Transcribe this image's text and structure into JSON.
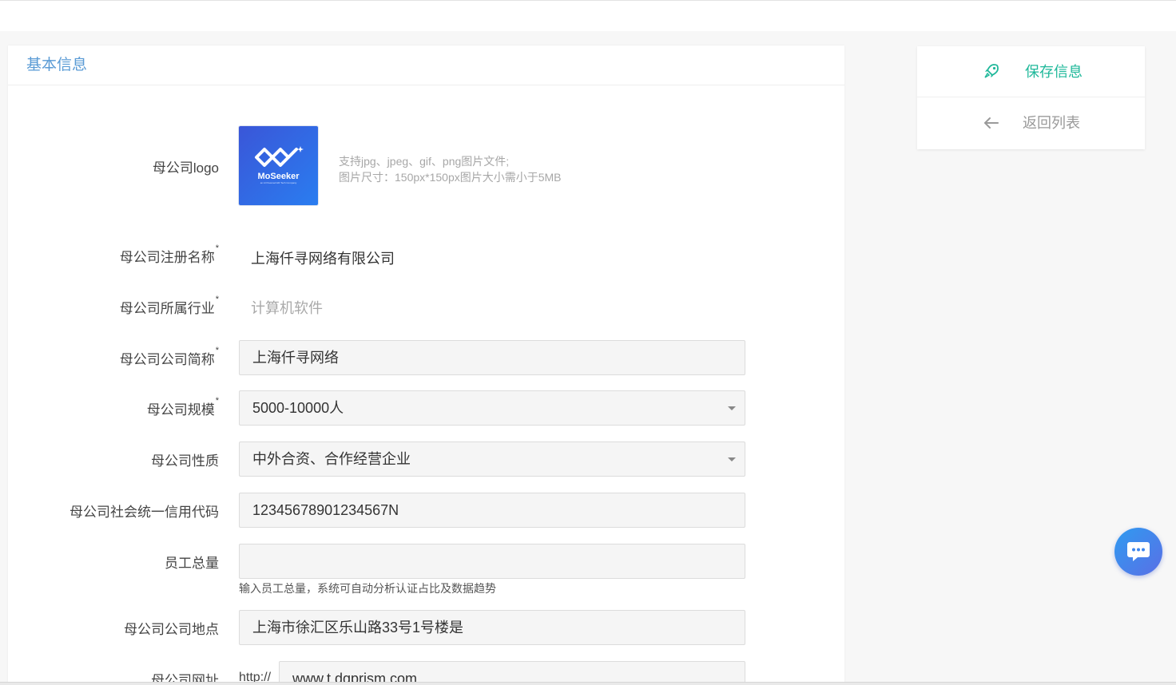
{
  "section": {
    "title": "基本信息"
  },
  "logo": {
    "label": "母公司logo",
    "brand_text": "MoSeeker",
    "brand_tagline": "an AI Powered HR Tech Company",
    "hint_line1": "支持jpg、jpeg、gif、png图片文件;",
    "hint_line2": "图片尺寸：150px*150px图片大小需小于5MB"
  },
  "fields": {
    "reg_name": {
      "label": "母公司注册名称",
      "value": "上海仟寻网络有限公司"
    },
    "industry": {
      "label": "母公司所属行业",
      "value": "计算机软件"
    },
    "short_name": {
      "label": "母公司公司简称",
      "value": "上海仟寻网络"
    },
    "scale": {
      "label": "母公司规模",
      "value": "5000-10000人"
    },
    "nature": {
      "label": "母公司性质",
      "value": "中外合资、合作经营企业"
    },
    "credit_code": {
      "label": "母公司社会统一信用代码",
      "value": "12345678901234567N"
    },
    "employees": {
      "label": "员工总量",
      "value": "",
      "hint": "输入员工总量，系统可自动分析认证占比及数据趋势"
    },
    "address": {
      "label": "母公司公司地点",
      "value": "上海市徐汇区乐山路33号1号楼是"
    },
    "website": {
      "label": "母公司网址",
      "prefix": "http://",
      "value": "www.t.dqprism.com"
    }
  },
  "required_mark": "*",
  "actions": {
    "save_label": "保存信息",
    "back_label": "返回列表"
  },
  "colors": {
    "accent_green": "#1fb89a",
    "section_title_blue": "#5a9bd5",
    "chat_blue": "#2f9bf0"
  },
  "icons": {
    "save": "rocket-icon",
    "back": "arrow-left-icon",
    "chat": "chat-bubble-icon"
  }
}
